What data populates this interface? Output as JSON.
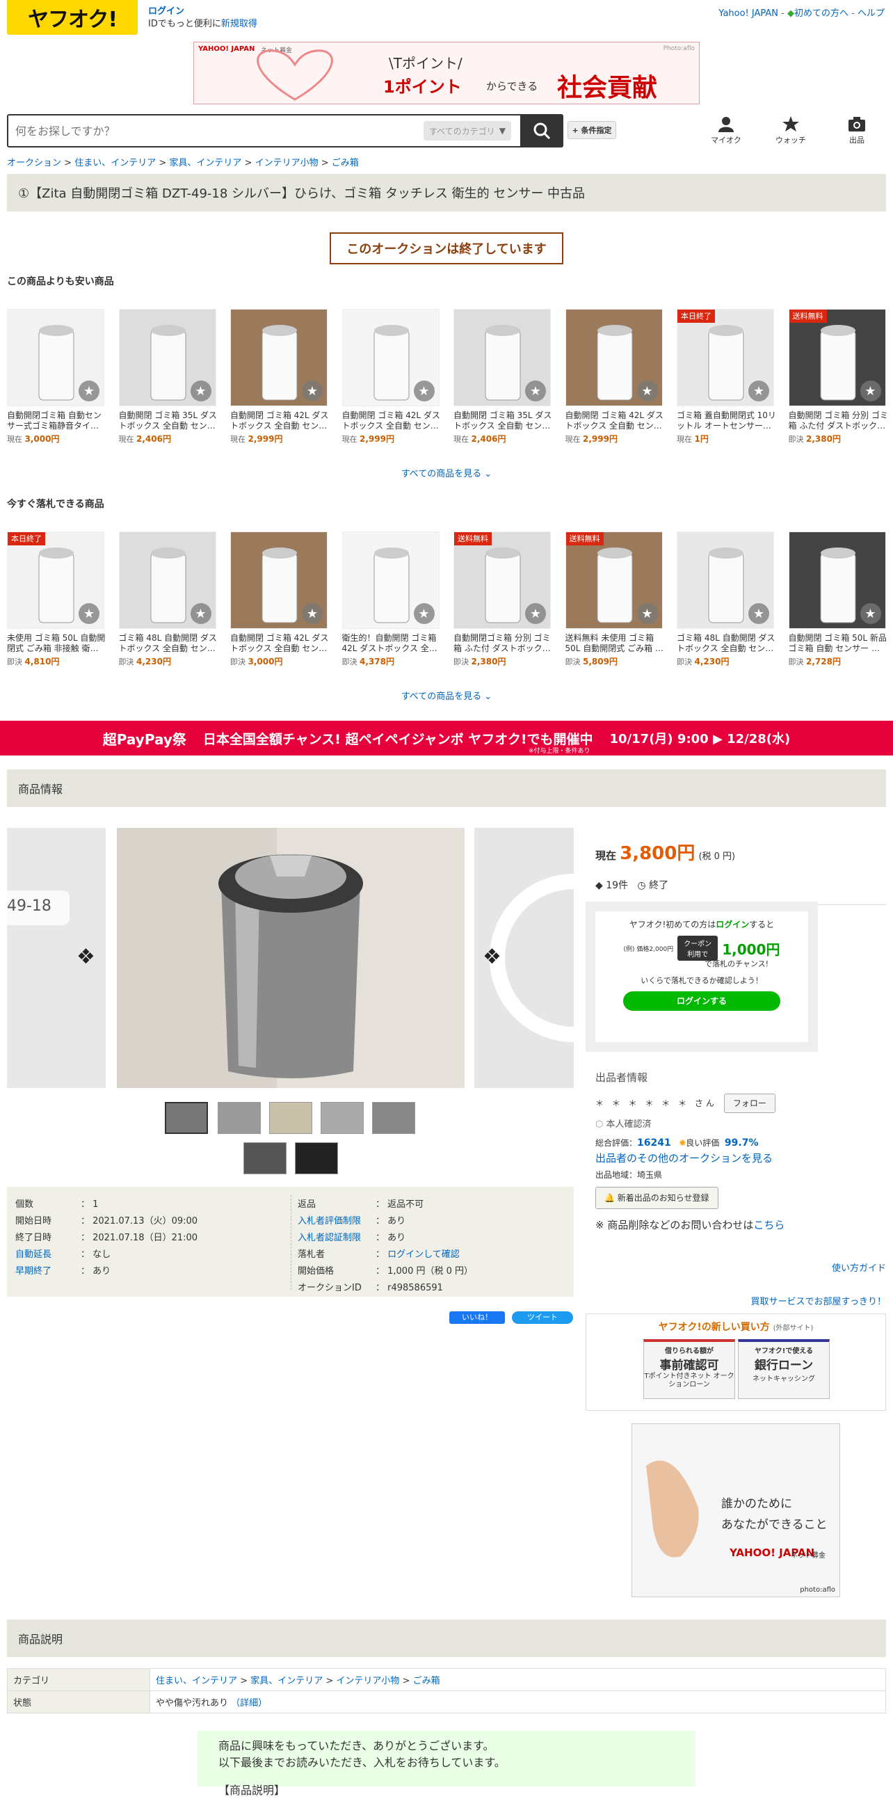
{
  "header": {
    "logo": "ヤフオク!",
    "login": "ログイン",
    "login_sub_prefix": "IDでもっと便利に",
    "register": "新規取得",
    "top_links": {
      "yahoo": "Yahoo! JAPAN",
      "first": "初めての方へ",
      "help": "ヘルプ"
    }
  },
  "top_banner": {
    "credit": "Photo:aflo",
    "tpoint": "\\Tポイント/",
    "line1": "1ポイント",
    "line1b": "からできる",
    "line2": "社会貢献",
    "brand": "YAHOO! JAPAN",
    "brand2": "ネット募金"
  },
  "search": {
    "placeholder": "何をお探しですか？",
    "category": "すべてのカテゴリ",
    "conditions": "+ 条件指定"
  },
  "nav_icons": {
    "myauc": "マイオク",
    "watch": "ウォッチ",
    "sell": "出品"
  },
  "breadcrumb": [
    "オークション",
    "住まい、インテリア",
    "家具、インテリア",
    "インテリア小物",
    "ごみ箱"
  ],
  "item_title": "①【Zita 自動開閉ゴミ箱 DZT-49-18 シルバー】ひらけ、ゴミ箱 タッチレス 衛生的 センサー 中古品",
  "ended_notice": "このオークションは終了しています",
  "cheaper": {
    "heading": "この商品よりも安い商品",
    "see_all": "すべての商品を見る",
    "items": [
      {
        "name": "自動開閉ゴミ箱 自動センサー式ゴミ箱静音タイ…",
        "label": "現在",
        "price": "3,000円",
        "tag": ""
      },
      {
        "name": "自動開閉 ゴミ箱 35L ダストボックス 全自動 セン…",
        "label": "現在",
        "price": "2,406円",
        "tag": ""
      },
      {
        "name": "自動開閉 ゴミ箱 42L ダストボックス 全自動 セン…",
        "label": "現在",
        "price": "2,999円",
        "tag": ""
      },
      {
        "name": "自動開閉 ゴミ箱 42L ダストボックス 全自動 セン…",
        "label": "現在",
        "price": "2,999円",
        "tag": ""
      },
      {
        "name": "自動開閉 ゴミ箱 35L ダストボックス 全自動 セン…",
        "label": "現在",
        "price": "2,406円",
        "tag": ""
      },
      {
        "name": "自動開閉 ゴミ箱 42L ダストボックス 全自動 セン…",
        "label": "現在",
        "price": "2,999円",
        "tag": ""
      },
      {
        "name": "ゴミ箱 蓋自動開閉式 10リットル オートセンサー…",
        "label": "現在",
        "price": "1円",
        "tag": "本日終了"
      },
      {
        "name": "自動開閉 ゴミ箱 分別 ゴミ箱 ふた付 ダストボック…",
        "label": "即決",
        "price": "2,380円",
        "tag": "送料無料"
      }
    ]
  },
  "buynow": {
    "heading": "今すぐ落札できる商品",
    "see_all": "すべての商品を見る",
    "items": [
      {
        "name": "未使用 ゴミ箱 50L 自動開閉式 ごみ箱 非接触 衛…",
        "label": "即決",
        "price": "4,810円",
        "tag": "本日終了"
      },
      {
        "name": "ゴミ箱 48L 自動開閉 ダストボックス 全自動 セン…",
        "label": "即決",
        "price": "4,230円",
        "tag": ""
      },
      {
        "name": "自動開閉 ゴミ箱 42L ダストボックス 全自動 セン…",
        "label": "即決",
        "price": "3,000円",
        "tag": ""
      },
      {
        "name": "衛生的！自動開閉 ゴミ箱 42L ダストボックス 全…",
        "label": "即決",
        "price": "4,378円",
        "tag": ""
      },
      {
        "name": "自動開閉ゴミ箱 分別 ゴミ箱 ふた付 ダストボック…",
        "label": "即決",
        "price": "2,380円",
        "tag": "送料無料"
      },
      {
        "name": "送料無料 未使用 ゴミ箱 50L 自動開閉式 ごみ箱 …",
        "label": "即決",
        "price": "5,809円",
        "tag": "送料無料"
      },
      {
        "name": "ゴミ箱 48L 自動開閉 ダストボックス 全自動 セン…",
        "label": "即決",
        "price": "4,230円",
        "tag": ""
      },
      {
        "name": "自動開閉 ゴミ箱 50L 新品 ゴミ箱 自動 センサー …",
        "label": "即決",
        "price": "2,728円",
        "tag": ""
      }
    ]
  },
  "mid_banner": {
    "left": "超PayPay祭",
    "mid": "日本全国全額チャンス! 超ペイペイジャンボ ヤフオク!でも開催中",
    "dates": "10/17(月) 9:00 ▶ 12/28(水)",
    "note": "※付与上限・条件あり"
  },
  "section_item_info": "商品情報",
  "price_box": {
    "label": "現在",
    "price": "3,800円",
    "tax": "(税 0 円)",
    "bids": "19件",
    "status": "終了"
  },
  "promo": {
    "line1a": "ヤフオク!初めての方は",
    "line1b": "ログイン",
    "line1c": "すると",
    "example": "(例) 価格2,000円",
    "coupon": "クーポン 利用で",
    "amount": "1,000円",
    "chance": "で落札のチャンス!",
    "check": "いくらで落札できるか確認しよう！",
    "btn": "ログインする"
  },
  "seller": {
    "heading": "出品者情報",
    "name": "＊ ＊ ＊ ＊ ＊ ＊ さん",
    "follow": "フォロー",
    "verified": "本人確認済",
    "rating_label": "総合評価：",
    "rating": "16241",
    "good_label": "良い評価",
    "good": "99.7%",
    "other": "出品者のその他のオークションを見る",
    "region": "出品地域：埼玉県",
    "notify": "新着出品のお知らせ登録",
    "inquiry_prefix": "※ 商品削除などのお問い合わせは",
    "inquiry_link": "こちら",
    "guide": "使い方ガイド",
    "shopping": "買取サービスでお部屋すっきり！"
  },
  "new_buy": {
    "title": "ヤフオク!の新しい買い方",
    "ext": "(外部サイト)",
    "card1": {
      "top": "借りられる額が",
      "main": "事前確認可",
      "sub": "Tポイント付きネット オークションローン"
    },
    "card2": {
      "top": "ヤフオク!で使える",
      "main": "銀行ローン",
      "sub": "ネットキャッシング"
    }
  },
  "ad_right": {
    "line1": "誰かのために",
    "line2": "あなたができること",
    "brand": "YAHOO! JAPAN",
    "brand2": "ネット募金",
    "credit": "photo:aflo"
  },
  "specs": {
    "left": [
      {
        "k": "個数",
        "v": "1",
        "link": false
      },
      {
        "k": "開始日時",
        "v": "2021.07.13（火）09:00",
        "link": false
      },
      {
        "k": "終了日時",
        "v": "2021.07.18（日）21:00",
        "link": false
      },
      {
        "k": "自動延長",
        "v": "なし",
        "link": true
      },
      {
        "k": "早期終了",
        "v": "あり",
        "link": true
      }
    ],
    "right": [
      {
        "k": "返品",
        "v": "返品不可",
        "link": false
      },
      {
        "k": "入札者評価制限",
        "v": "あり",
        "link": true
      },
      {
        "k": "入札者認証制限",
        "v": "あり",
        "link": true
      },
      {
        "k": "落札者",
        "v": "ログインして確認",
        "link": false
      },
      {
        "k": "開始価格",
        "v": "1,000 円（税 0 円）",
        "link": false
      },
      {
        "k": "オークションID",
        "v": "r498586591",
        "link": false
      }
    ]
  },
  "social": {
    "like": "いいね！",
    "tweet": "ツイート"
  },
  "section_desc": "商品説明",
  "desc_table": {
    "cat_label": "カテゴリ",
    "cat_links": [
      "住まい、インテリア",
      "家具、インテリア",
      "インテリア小物",
      "ごみ箱"
    ],
    "cond_label": "状態",
    "cond_value": "やや傷や汚れあり",
    "cond_detail": "（詳細）"
  },
  "message": {
    "line1": "商品に興味をもっていただき、ありがとうございます。",
    "line2": "以下最後までお読みいただき、入札をお待ちしています。",
    "line3": "【商品説明】"
  },
  "gallery": {
    "watermark": "49-18"
  }
}
